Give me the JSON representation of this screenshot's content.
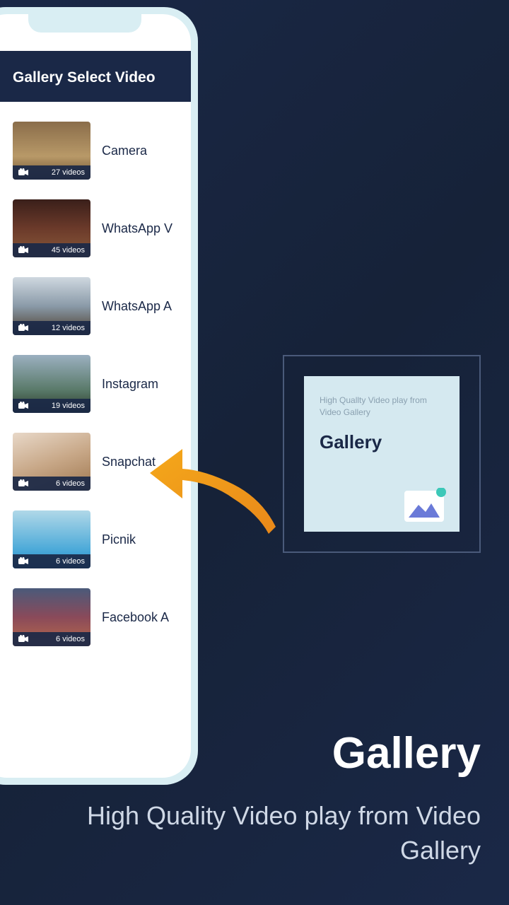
{
  "app": {
    "header_title": "Gallery Select Video"
  },
  "folders": [
    {
      "label": "Camera",
      "count": "27 videos",
      "thumb": "guitar"
    },
    {
      "label": "WhatsApp V",
      "count": "45 videos",
      "thumb": "wedding"
    },
    {
      "label": "WhatsApp A",
      "count": "12 videos",
      "thumb": "horse"
    },
    {
      "label": "Instagram",
      "count": "19 videos",
      "thumb": "landscape"
    },
    {
      "label": "Snapchat",
      "count": "6 videos",
      "thumb": "couple"
    },
    {
      "label": "Picnik",
      "count": "6 videos",
      "thumb": "pool"
    },
    {
      "label": "Facebook A",
      "count": "6 videos",
      "thumb": "pagoda"
    }
  ],
  "card": {
    "subtitle": "High Quallty Video play from Video Gallery",
    "title": "Gallery"
  },
  "hero": {
    "title": "Gallery",
    "subtitle": "High Quality Video play from Video Gallery"
  },
  "thumbs": {
    "guitar": {
      "bg": "linear-gradient(180deg,#8a6d4a 0%,#b89968 60%,#6b4e2e 100%)"
    },
    "wedding": {
      "bg": "linear-gradient(180deg,#3a1f1a 0%,#6b3a2a 50%,#8a5a3a 100%)"
    },
    "horse": {
      "bg": "linear-gradient(180deg,#cfd8e0 0%,#8a9aa8 50%,#4a3a2a 100%)"
    },
    "landscape": {
      "bg": "linear-gradient(180deg,#9bb0c0 0%,#5a7a6a 60%,#2a3a2a 100%)"
    },
    "couple": {
      "bg": "linear-gradient(160deg,#e8d8c8 0%,#c8a888 50%,#a07850 100%)"
    },
    "pool": {
      "bg": "linear-gradient(180deg,#b0d8e8 0%,#48a8d8 70%,#2888c0 100%)"
    },
    "pagoda": {
      "bg": "linear-gradient(180deg,#4a5a7a 0%,#8a4a5a 50%,#b86a4a 100%)"
    }
  }
}
